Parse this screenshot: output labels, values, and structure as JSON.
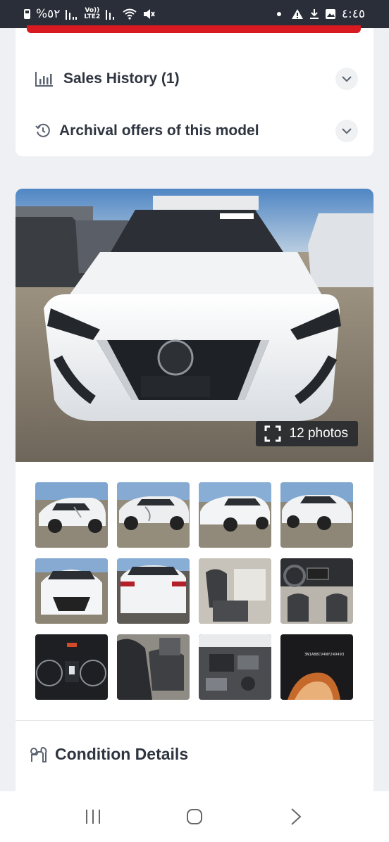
{
  "status_bar": {
    "battery_text": "%٥٢",
    "carrier_badge": [
      "Vo))",
      "LTE2"
    ],
    "time": "٤:٤٥",
    "icons": [
      "battery-icon",
      "signal-icon",
      "wifi-icon",
      "mute-icon",
      "warning-icon",
      "download-icon",
      "image-icon"
    ]
  },
  "accordion": {
    "sales_history_label": "Sales History (1)",
    "archival_label": "Archival offers of this model"
  },
  "gallery": {
    "photos_count_label": "12 photos",
    "thumbnails": [
      {
        "name": "front-left-damage"
      },
      {
        "name": "side-damage"
      },
      {
        "name": "front-right"
      },
      {
        "name": "front-right-2"
      },
      {
        "name": "front"
      },
      {
        "name": "rear"
      },
      {
        "name": "interior-front-seats"
      },
      {
        "name": "dashboard"
      },
      {
        "name": "instrument-cluster"
      },
      {
        "name": "rear-seats"
      },
      {
        "name": "engine-bay"
      },
      {
        "name": "vin-plate",
        "text": "3N1AB8CV4NY249493"
      }
    ]
  },
  "condition": {
    "title": "Condition Details"
  },
  "colors": {
    "accent_red": "#d81920",
    "status_bar": "#2a2e38",
    "text_dark": "#2f3540"
  }
}
